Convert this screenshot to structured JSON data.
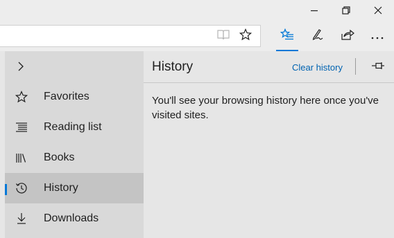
{
  "window": {
    "buttons": [
      {
        "name": "minimize",
        "icon": "minimize-icon"
      },
      {
        "name": "restore",
        "icon": "restore-icon"
      },
      {
        "name": "close",
        "icon": "close-icon"
      }
    ]
  },
  "address_bar": {
    "value": "",
    "icons": [
      "reading-view-icon",
      "add-favorite-star-icon"
    ]
  },
  "toolbar": {
    "buttons": [
      {
        "name": "hub",
        "icon": "hub-star-lines-icon",
        "active": true
      },
      {
        "name": "web-note",
        "icon": "pen-icon"
      },
      {
        "name": "share",
        "icon": "share-icon"
      },
      {
        "name": "more",
        "icon": "ellipsis-icon"
      }
    ]
  },
  "hub": {
    "nav": [
      {
        "label": "Favorites",
        "icon": "star-icon"
      },
      {
        "label": "Reading list",
        "icon": "reading-list-icon"
      },
      {
        "label": "Books",
        "icon": "books-icon"
      },
      {
        "label": "History",
        "icon": "history-icon",
        "active": true
      },
      {
        "label": "Downloads",
        "icon": "download-icon"
      }
    ],
    "panel": {
      "title": "History",
      "clear_label": "Clear history",
      "empty_message": "You'll see your browsing history here once you've visited sites."
    }
  },
  "colors": {
    "accent": "#0078d7",
    "link": "#0063b1",
    "left_pane_bg": "#d9d9d9",
    "active_item_bg": "#c4c4c4",
    "panel_bg": "#e6e6e6"
  }
}
